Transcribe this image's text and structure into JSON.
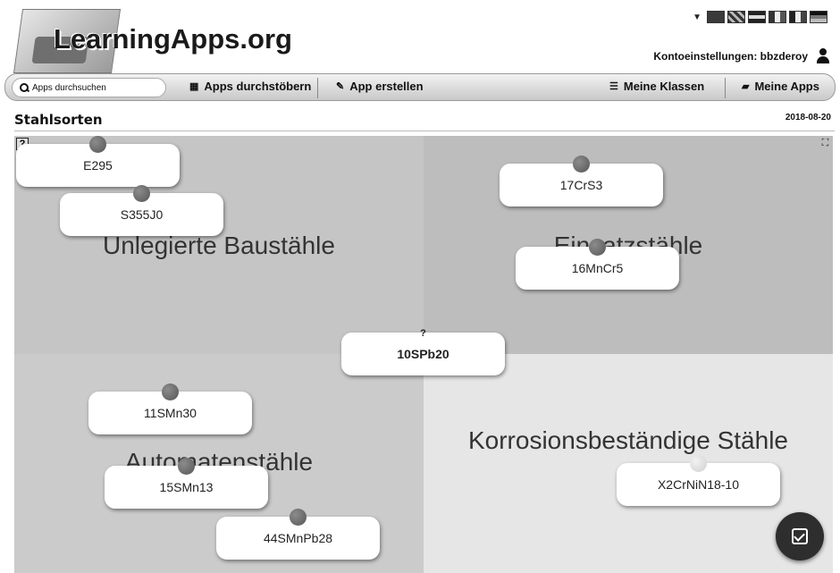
{
  "header": {
    "logo_text": "LearningApps.org",
    "account_label": "Kontoeinstellungen: bbzderoy"
  },
  "nav": {
    "search_placeholder": "Apps durchsuchen",
    "browse_label": "Apps durchstöbern",
    "create_label": "App erstellen",
    "classes_label": "Meine Klassen",
    "myapps_label": "Meine Apps"
  },
  "page": {
    "title": "Stahlsorten",
    "date": "2018-08-20"
  },
  "zones": {
    "unalloyed": "Unlegierte Baustähle",
    "case_hardening": "Einsatzstähle",
    "free_cutting": "Automatenstähle",
    "stainless": "Korrosionsbeständige Stähle"
  },
  "cards": {
    "e295": "E295",
    "s355j0": "S355J0",
    "c17crs3": "17CrS3",
    "c16mncr5": "16MnCr5",
    "c10spb20": "10SPb20",
    "c10spb20_mark": "?",
    "c11smn30": "11SMn30",
    "c15smn13": "15SMn13",
    "c44smnpb28": "44SMnPb28",
    "x2crnin18": "X2CrNiN18-10"
  }
}
